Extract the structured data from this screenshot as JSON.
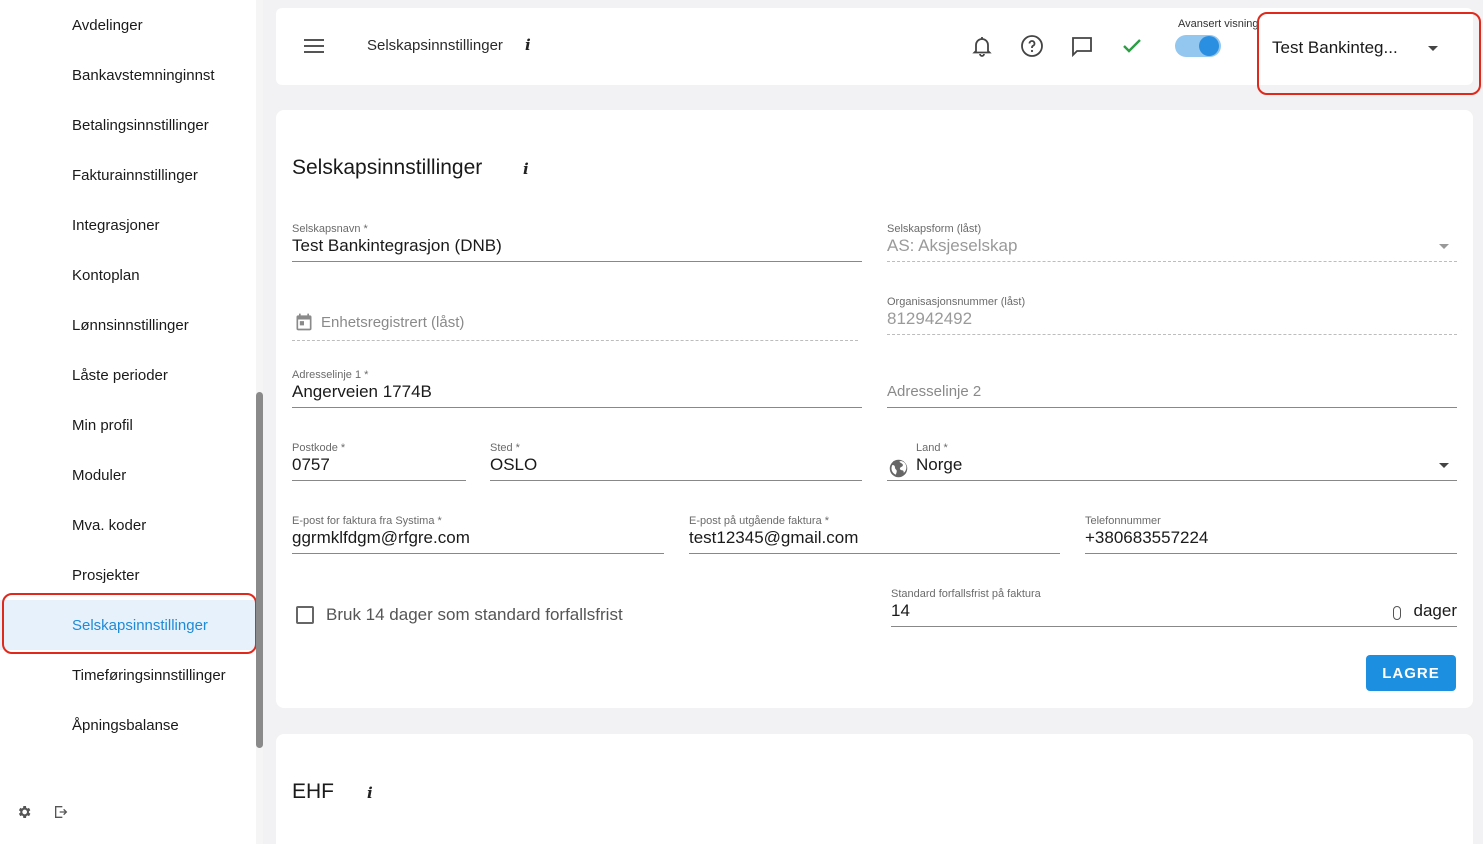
{
  "sidebar": {
    "items": [
      {
        "label": "Avdelinger"
      },
      {
        "label": "Bankavstemninginnst"
      },
      {
        "label": "Betalingsinnstillinger"
      },
      {
        "label": "Fakturainnstillinger"
      },
      {
        "label": "Integrasjoner"
      },
      {
        "label": "Kontoplan"
      },
      {
        "label": "Lønnsinnstillinger"
      },
      {
        "label": "Låste perioder"
      },
      {
        "label": "Min profil"
      },
      {
        "label": "Moduler"
      },
      {
        "label": "Mva. koder"
      },
      {
        "label": "Prosjekter"
      },
      {
        "label": "Selskapsinnstillinger",
        "active": true
      },
      {
        "label": "Timeføringsinnstillinger"
      },
      {
        "label": "Åpningsbalanse"
      }
    ],
    "footer_icons": [
      "gear-icon",
      "logout-icon"
    ]
  },
  "header": {
    "title": "Selskapsinnstillinger",
    "info": "i",
    "toggle_label": "Avansert visning",
    "toggle_on": true,
    "company": "Test Bankinteg...",
    "icons": [
      "bell-icon",
      "help-icon",
      "chat-icon",
      "check-icon"
    ],
    "accent": "#1d8fe1",
    "check_color": "#2e9e45"
  },
  "form": {
    "title": "Selskapsinnstillinger",
    "info": "i",
    "company_name": {
      "label": "Selskapsnavn *",
      "value": "Test Bankintegrasjon (DNB)"
    },
    "company_form": {
      "label": "Selskapsform (låst)",
      "value": "AS: Aksjeselskap"
    },
    "registered": {
      "placeholder": "Enhetsregistrert (låst)"
    },
    "org_number": {
      "label": "Organisasjonsnummer (låst)",
      "value": "812942492"
    },
    "address1": {
      "label": "Adresselinje 1 *",
      "value": "Angerveien 1774B"
    },
    "address2": {
      "placeholder": "Adresselinje 2"
    },
    "postcode": {
      "label": "Postkode *",
      "value": "0757"
    },
    "city": {
      "label": "Sted *",
      "value": "OSLO"
    },
    "country": {
      "label": "Land *",
      "value": "Norge"
    },
    "invoice_email": {
      "label": "E-post for faktura fra Systima *",
      "value": "ggrmklfdgm@rfgre.com"
    },
    "outgoing_email": {
      "label": "E-post på utgående faktura *",
      "value": "test12345@gmail.com"
    },
    "phone": {
      "label": "Telefonnummer",
      "value": "+380683557224"
    },
    "checkbox_label": "Bruk 14 dager som standard forfallsfrist",
    "checkbox_checked": false,
    "due_days": {
      "label": "Standard forfallsfrist på faktura",
      "value": "14",
      "suffix": "dager"
    },
    "save_label": "LAGRE"
  },
  "ehf": {
    "title": "EHF",
    "info": "i"
  }
}
